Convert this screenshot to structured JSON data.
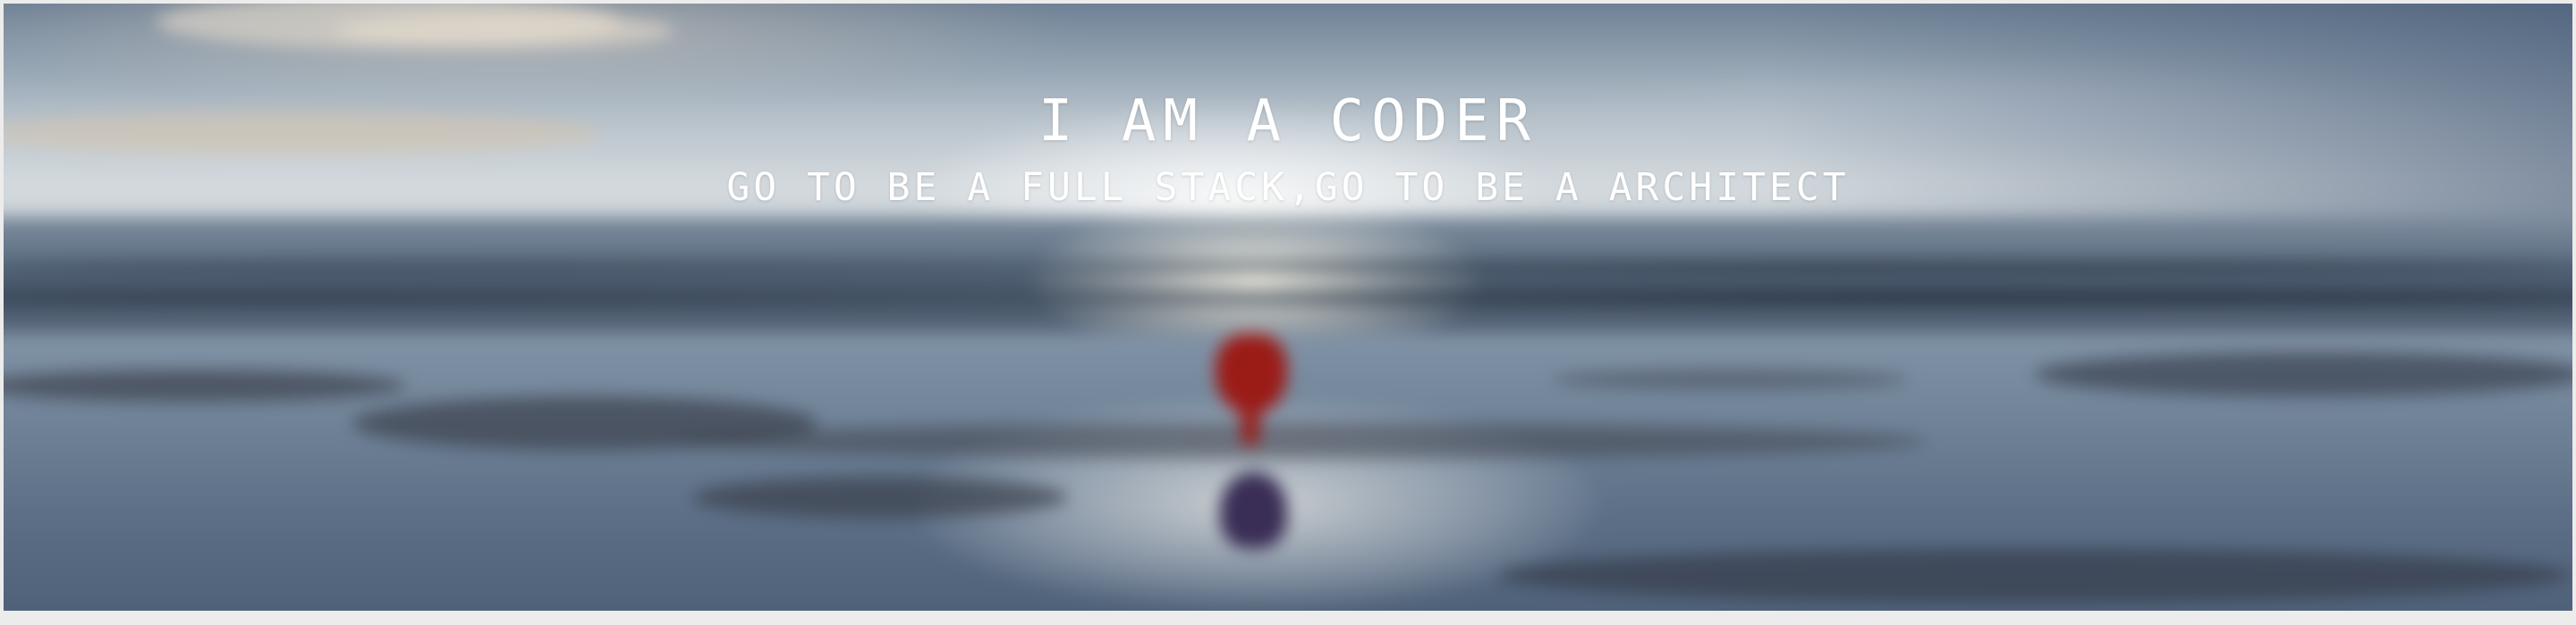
{
  "hero": {
    "title": "I AM A CODER",
    "subtitle": "GO TO BE A FULL STACK,GO TO BE A ARCHITECT"
  },
  "background_image": {
    "subject": "blurred-beach-with-red-heart-sculpture-icon"
  },
  "colors": {
    "text": "#ffffff",
    "heart": "#9b1b17",
    "page_background": "#ececec"
  }
}
